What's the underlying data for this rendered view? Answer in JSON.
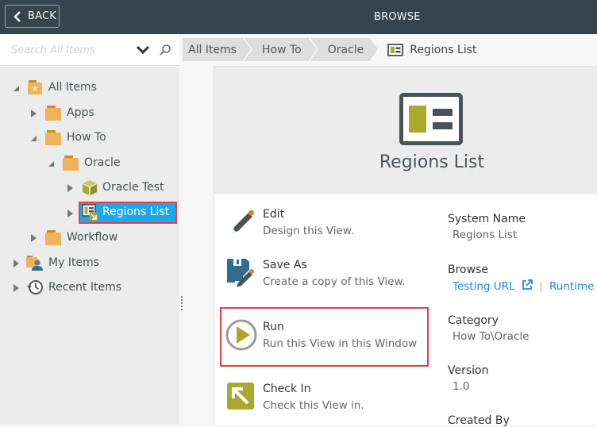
{
  "topbar": {
    "back_label": "BACK",
    "title": "BROWSE"
  },
  "search": {
    "placeholder": "Search All Items",
    "value": ""
  },
  "tree": {
    "items": [
      {
        "label": "All Items",
        "icon": "all-items-folder-icon",
        "expanded": true
      },
      {
        "label": "Apps",
        "icon": "folder-icon",
        "expanded": false
      },
      {
        "label": "How To",
        "icon": "folder-icon",
        "expanded": true
      },
      {
        "label": "Oracle",
        "icon": "folder-icon",
        "expanded": true
      },
      {
        "label": "Oracle Test",
        "icon": "smartobject-cube-icon",
        "expanded": false
      },
      {
        "label": "Regions List",
        "icon": "view-icon",
        "expanded": false,
        "selected": true
      },
      {
        "label": "Workflow",
        "icon": "folder-icon",
        "expanded": false
      },
      {
        "label": "My Items",
        "icon": "my-items-icon",
        "expanded": false
      },
      {
        "label": "Recent Items",
        "icon": "recent-items-icon",
        "expanded": false
      }
    ]
  },
  "breadcrumb": {
    "items": [
      "All Items",
      "How To",
      "Oracle"
    ],
    "current": "Regions List"
  },
  "detail": {
    "title": "Regions List",
    "actions": [
      {
        "title": "Edit",
        "desc": "Design this View.",
        "icon": "pencil-icon"
      },
      {
        "title": "Save As",
        "desc": "Create a copy of this View.",
        "icon": "save-as-icon"
      },
      {
        "title": "Run",
        "desc": "Run this View in this Window",
        "icon": "run-play-icon"
      },
      {
        "title": "Check In",
        "desc": "Check this View in.",
        "icon": "check-in-arrow-icon"
      }
    ],
    "properties": {
      "system_name_label": "System Name",
      "system_name_value": "Regions List",
      "browse_label": "Browse",
      "browse_link1": "Testing URL",
      "browse_sep": "|",
      "browse_link2": "Runtime",
      "category_label": "Category",
      "category_value": "How To\\Oracle",
      "version_label": "Version",
      "version_value": "1.0",
      "created_by_label": "Created By"
    }
  },
  "colors": {
    "topbar": "#36454d",
    "selected": "#1ea7ef",
    "highlight_border": "#e8404a",
    "accent_olive": "#a8aa2e",
    "link": "#1f8ae0",
    "folder": "#f0b35c"
  }
}
